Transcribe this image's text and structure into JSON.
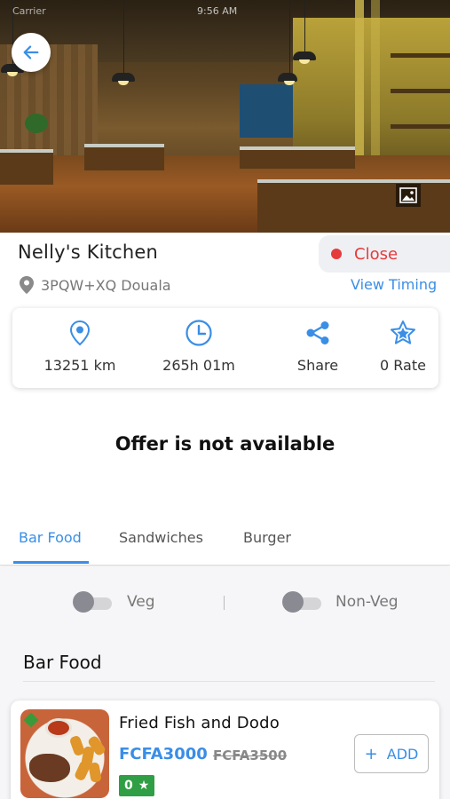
{
  "status_bar": {
    "carrier": "Carrier",
    "time": "9:56 AM"
  },
  "restaurant": {
    "name": "Nelly's Kitchen",
    "status": "Close",
    "address": "3PQW+XQ Douala",
    "view_timing": "View Timing"
  },
  "info": {
    "distance": "13251 km",
    "duration": "265h 01m",
    "share": "Share",
    "rate": "0 Rate"
  },
  "offer_text": "Offer is not available",
  "tabs": [
    {
      "label": "Bar Food"
    },
    {
      "label": "Sandwiches"
    },
    {
      "label": "Burger"
    }
  ],
  "filters": {
    "veg": "Veg",
    "non_veg": "Non-Veg"
  },
  "section_title": "Bar Food",
  "items": [
    {
      "name": "Fried Fish and Dodo",
      "price": "FCFA3000",
      "old_price": "FCFA3500",
      "rating": "0",
      "add_label": "ADD"
    }
  ],
  "colors": {
    "accent": "#3a8ee6",
    "closed": "#e53b3b",
    "rating_bg": "#2f9e44"
  },
  "icons": {
    "back": "arrow-left-icon",
    "gallery": "image-icon",
    "location": "map-pin-icon",
    "clock": "clock-icon",
    "share": "share-icon",
    "rate": "star-icon"
  }
}
